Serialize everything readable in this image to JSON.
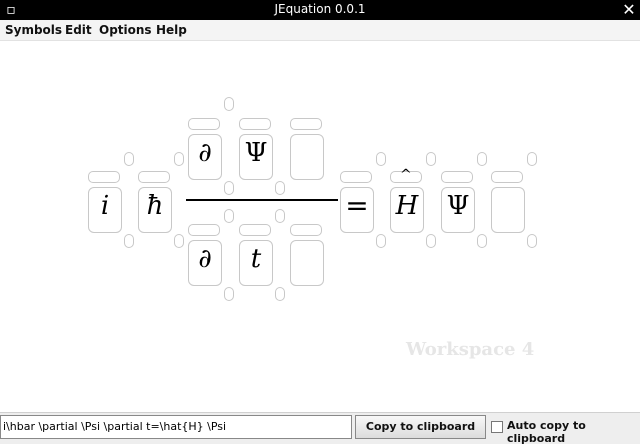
{
  "window": {
    "title": "JEquation 0.0.1",
    "close_glyph": "✕",
    "menu_glyph": "▫"
  },
  "menu": [
    "Symbols",
    "Edit",
    "Options",
    "Help"
  ],
  "equation": {
    "lhs": [
      "i",
      "ħ"
    ],
    "numerator": [
      "∂",
      "Ψ"
    ],
    "denominator": [
      "∂",
      "t"
    ],
    "equals": "=",
    "hat": "^",
    "rhs": [
      "H",
      "Ψ"
    ]
  },
  "workspace": {
    "watermark": "Workspace 4"
  },
  "bottom": {
    "latex_value": "i\\hbar \\partial \\Psi \\partial t=\\hat{H} \\Psi",
    "copy_label": "Copy to clipboard",
    "auto_copy_label": "Auto copy to clipboard",
    "auto_copy_checked": false
  }
}
